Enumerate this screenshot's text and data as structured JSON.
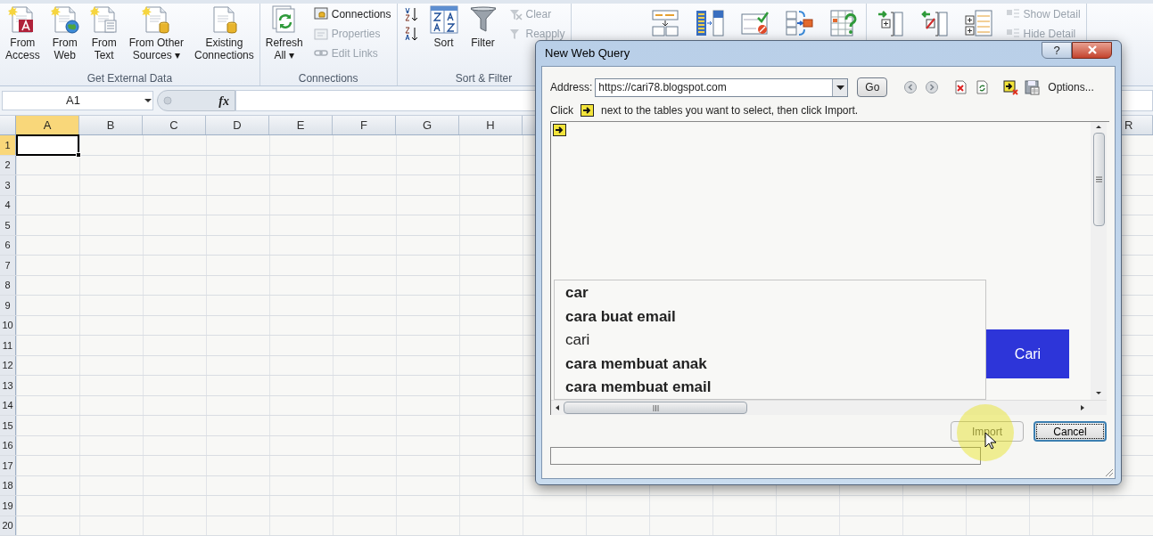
{
  "ribbon": {
    "groups": [
      {
        "label": "Get External Data",
        "items": [
          {
            "kind": "large",
            "label": "From\nAccess",
            "disabled": false
          },
          {
            "kind": "large",
            "label": "From\nWeb",
            "disabled": false
          },
          {
            "kind": "large",
            "label": "From\nText",
            "disabled": false
          },
          {
            "kind": "large",
            "label": "From Other\nSources ▾",
            "disabled": false
          },
          {
            "kind": "large",
            "label": "Existing\nConnections",
            "disabled": false
          }
        ]
      },
      {
        "label": "Connections",
        "items": [
          {
            "kind": "large",
            "label": "Refresh\nAll ▾",
            "disabled": false
          },
          {
            "kind": "small",
            "label": "Connections",
            "disabled": false
          },
          {
            "kind": "small",
            "label": "Properties",
            "disabled": true
          },
          {
            "kind": "small",
            "label": "Edit Links",
            "disabled": true
          }
        ]
      },
      {
        "label": "Sort & Filter",
        "items": [
          {
            "kind": "small_icon"
          },
          {
            "kind": "small_icon"
          },
          {
            "kind": "large",
            "label": "Sort",
            "disabled": false
          },
          {
            "kind": "large",
            "label": "Filter",
            "disabled": false
          },
          {
            "kind": "small",
            "label": "Clear",
            "disabled": true
          },
          {
            "kind": "small",
            "label": "Reapply",
            "disabled": true
          }
        ]
      },
      {
        "items": [
          {
            "kind": "icon"
          },
          {
            "kind": "icon"
          },
          {
            "kind": "icon"
          },
          {
            "kind": "icon"
          },
          {
            "kind": "icon"
          }
        ]
      },
      {
        "items": [
          {
            "kind": "icon"
          },
          {
            "kind": "icon"
          },
          {
            "kind": "icon"
          },
          {
            "kind": "small",
            "label": "Show Detail",
            "disabled": true
          },
          {
            "kind": "small",
            "label": "Hide Detail",
            "disabled": true
          }
        ]
      }
    ]
  },
  "formula_bar": {
    "name_box": "A1",
    "function_label": "fx"
  },
  "sheet": {
    "columns": [
      {
        "label": "A",
        "selected": true
      },
      {
        "label": "B",
        "selected": false
      },
      {
        "label": "C",
        "selected": false
      },
      {
        "label": "D",
        "selected": false
      },
      {
        "label": "E",
        "selected": false
      },
      {
        "label": "F",
        "selected": false
      },
      {
        "label": "G",
        "selected": false
      },
      {
        "label": "H",
        "selected": false
      }
    ],
    "right_edge_columns": [
      {
        "label": "R",
        "selected": false
      }
    ],
    "rows": [
      {
        "label": "1",
        "selected": true
      },
      {
        "label": "2",
        "selected": false
      },
      {
        "label": "3",
        "selected": false
      },
      {
        "label": "4",
        "selected": false
      },
      {
        "label": "5",
        "selected": false
      },
      {
        "label": "6",
        "selected": false
      },
      {
        "label": "7",
        "selected": false
      },
      {
        "label": "8",
        "selected": false
      },
      {
        "label": "9",
        "selected": false
      },
      {
        "label": "10",
        "selected": false
      },
      {
        "label": "11",
        "selected": false
      },
      {
        "label": "12",
        "selected": false
      },
      {
        "label": "13",
        "selected": false
      },
      {
        "label": "14",
        "selected": false
      },
      {
        "label": "15",
        "selected": false
      },
      {
        "label": "16",
        "selected": false
      },
      {
        "label": "17",
        "selected": false
      },
      {
        "label": "18",
        "selected": false
      },
      {
        "label": "19",
        "selected": false
      },
      {
        "label": "20",
        "selected": false
      }
    ]
  },
  "dialog": {
    "title": "New Web Query",
    "help": "?",
    "address_label": "Address:",
    "address": "https://cari78.blogspot.com",
    "go": "Go",
    "options": "Options...",
    "instruction_start": "Click",
    "instruction_end": "next to the tables you want to select, then click Import.",
    "suggestions": [
      {
        "text": "car",
        "bold": true
      },
      {
        "text": "cara buat email",
        "bold": true
      },
      {
        "text": "cari",
        "bold": false
      },
      {
        "text": "cara membuat anak",
        "bold": true
      },
      {
        "text": "cara membuat email",
        "bold": true
      }
    ],
    "search_button": "Cari",
    "buttons": [
      {
        "label": "Import",
        "disabled": true,
        "default": false
      },
      {
        "label": "Cancel",
        "disabled": false,
        "default": true
      }
    ]
  }
}
